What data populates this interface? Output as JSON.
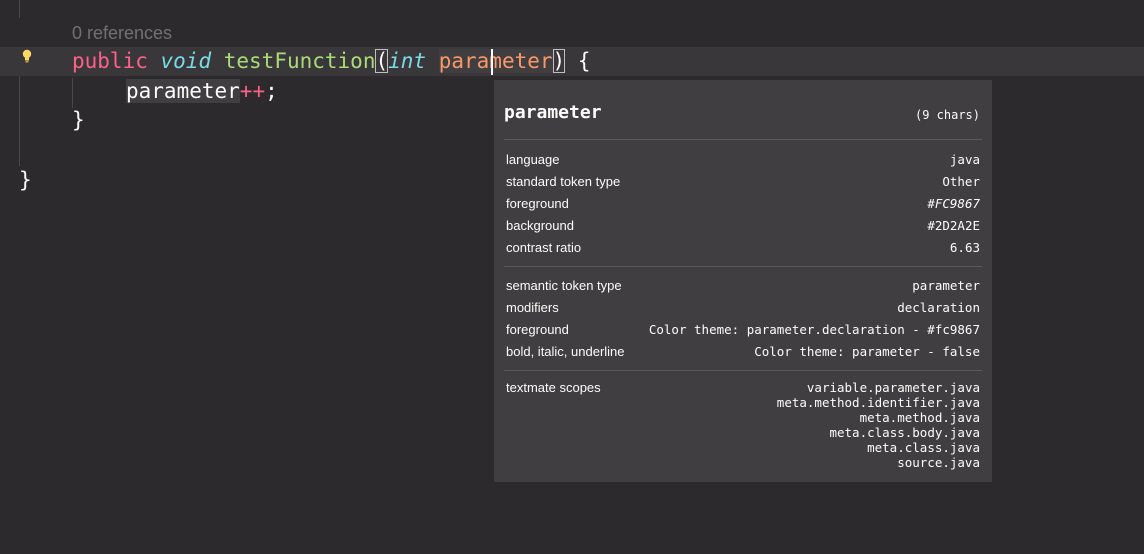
{
  "editor": {
    "codelens": "0 references",
    "line1": {
      "public": "public",
      "void": "void",
      "fn_name": "testFunction",
      "open_paren": "(",
      "int": "int",
      "param_a": "pa",
      "param_b": "rameter",
      "close_paren": ")",
      "brace": " {"
    },
    "line2": {
      "param": "parameter",
      "op": "++",
      "semi": ";"
    },
    "line3": "}",
    "line5": "}"
  },
  "hover": {
    "title": "parameter",
    "char_count": "(9 chars)",
    "section1": [
      {
        "label": "language",
        "value": "java"
      },
      {
        "label": "standard token type",
        "value": "Other"
      },
      {
        "label": "foreground",
        "value": "#FC9867"
      },
      {
        "label": "background",
        "value": "#2D2A2E"
      },
      {
        "label": "contrast ratio",
        "value": "6.63"
      }
    ],
    "section2": [
      {
        "label": "semantic token type",
        "value": "parameter"
      },
      {
        "label": "modifiers",
        "value": "declaration"
      },
      {
        "label": "foreground",
        "value": "Color theme: parameter.declaration - #fc9867"
      },
      {
        "label": "bold, italic, underline",
        "value": "Color theme: parameter - false"
      }
    ],
    "scopes_label": "textmate scopes",
    "scopes": [
      "variable.parameter.java",
      "meta.method.identifier.java",
      "meta.method.java",
      "meta.class.body.java",
      "meta.class.java",
      "source.java"
    ]
  },
  "colors": {
    "background": "#2d2a2e",
    "keyword": "#ff6188",
    "type": "#78dce8",
    "function": "#a9dc76",
    "parameter": "#fc9867",
    "lightbulb": "#ffd866"
  },
  "icons": {
    "lightbulb": "lightbulb-icon"
  }
}
